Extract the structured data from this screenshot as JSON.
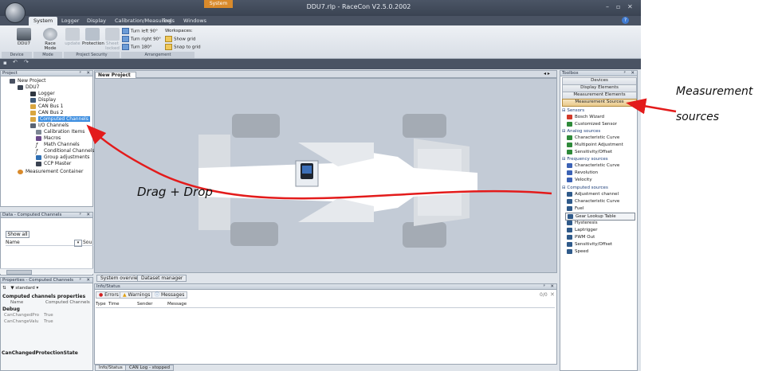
{
  "app": {
    "title": "DDU7.rlp - RaceCon V2.5.0.2002",
    "context_tab": "System",
    "window_controls": [
      "–",
      "▫",
      "✕"
    ],
    "help_label": "?"
  },
  "ribbon": {
    "tabs": [
      "System",
      "Logger",
      "Display",
      "Calibration/Measuring",
      "Tools",
      "Windows"
    ],
    "active_tab": "System",
    "buttons": {
      "ddu7": "DDU7",
      "race_mode": "Race Mode",
      "update": "update",
      "protection": "Protection",
      "sheet_locked": "Sheet locked",
      "turn_left": "Turn left 90°",
      "turn_right": "Turn right 90°",
      "turn_180": "Turn 180°",
      "workspaces": "Workspaces:",
      "show_grid": "Show grid",
      "snap_to_grid": "Snap to grid"
    },
    "groups": {
      "device": "Device",
      "mode": "Mode",
      "project_security": "Project Security",
      "arrangement": "Arrangement"
    }
  },
  "project_panel": {
    "title": "Project",
    "pin": "ᵖ",
    "close": "✕",
    "items": [
      {
        "label": "New Project"
      },
      {
        "label": "DDU7"
      },
      {
        "label": "Logger"
      },
      {
        "label": "Display"
      },
      {
        "label": "CAN Bus 1"
      },
      {
        "label": "CAN Bus 2"
      },
      {
        "label": "Computed Channels"
      },
      {
        "label": "I/O Channels"
      },
      {
        "label": "Calibration Items"
      },
      {
        "label": "Macros"
      },
      {
        "label": "Math Channels"
      },
      {
        "label": "Conditional Channels"
      },
      {
        "label": "Group adjustments"
      },
      {
        "label": "CCP Master"
      },
      {
        "label": "Measurement Container"
      }
    ]
  },
  "data_panel": {
    "title": "Data - Computed Channels",
    "show_all": "Show all",
    "name_col": "Name",
    "sort_col": "Sou"
  },
  "properties_panel": {
    "title": "Properties - Computed Channels",
    "dropdown": "standard",
    "section1": "Computed channels properties",
    "rows": [
      {
        "name": "Name",
        "value": "Computed Channels"
      }
    ],
    "section2": "Debug",
    "debug_rows": [
      {
        "name": "CanChangedPro",
        "value": "True"
      },
      {
        "name": "CanChangeValu",
        "value": "True"
      }
    ],
    "footer": "CanChangedProtectionState"
  },
  "document": {
    "tab": "New Project",
    "nav_arrows": "◂ ▸"
  },
  "bottom_tabs": {
    "system_overview": "System overview",
    "dataset_manager": "Dataset manager"
  },
  "info_panel": {
    "title": "Info/Status",
    "errors": "Errors",
    "warnings": "Warnings",
    "messages": "Messages",
    "counter": "0/0",
    "columns": [
      "Type",
      "Time",
      "Sender",
      "Message"
    ]
  },
  "status_tabs": {
    "info_status": "Info/Status",
    "can_log": "CAN Log - stopped"
  },
  "toolbox": {
    "title": "Toolbox",
    "buttons": [
      "Devices",
      "Display Elements",
      "Measurement Elements",
      "Measurement Sources"
    ],
    "active_button": "Measurement Sources",
    "categories": [
      {
        "label": "Sensors",
        "items": [
          "Bosch Wizard",
          "Customized Sensor"
        ]
      },
      {
        "label": "Analog sources",
        "items": [
          "Characteristic Curve",
          "Multipoint Adjustment",
          "Sensitivity/Offset"
        ]
      },
      {
        "label": "Frequency sources",
        "items": [
          "Characteristic Curve",
          "Revolution",
          "Velocity"
        ]
      },
      {
        "label": "Computed sources",
        "items": [
          "Adjustment channel",
          "Characteristic Curve",
          "Fuel",
          "Gear Lookup Table",
          "Hysteresis",
          "Laptrigger",
          "PWM Out",
          "Sensitivity/Offset",
          "Speed"
        ]
      }
    ]
  },
  "annotations": {
    "drag_drop": "Drag + Drop",
    "measurement_sources_line1": "Measurement",
    "measurement_sources_line2": "sources"
  },
  "colors": {
    "accent_arrow": "#e31b1b",
    "selection": "#3d8ee0",
    "title_bar": "#3f4857",
    "context_tab": "#d98a2b"
  }
}
